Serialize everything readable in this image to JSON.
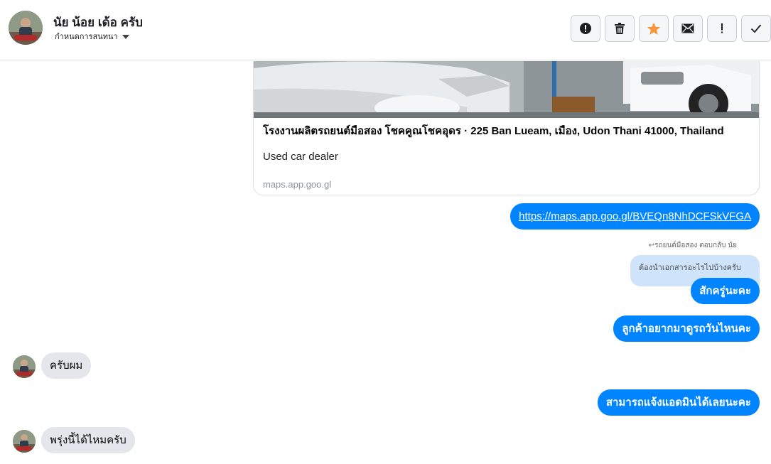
{
  "header": {
    "contact_name": "นัย น้อย เด้อ ครับ",
    "label_select": "กำหนดการสนทนา",
    "toolbar": [
      {
        "name": "report-button",
        "icon": "alert-circle-icon"
      },
      {
        "name": "delete-button",
        "icon": "trash-icon"
      },
      {
        "name": "star-button",
        "icon": "star-icon"
      },
      {
        "name": "mark-unread-button",
        "icon": "envelope-icon"
      },
      {
        "name": "important-button",
        "icon": "exclamation-icon"
      },
      {
        "name": "done-button",
        "icon": "checkmark-icon"
      }
    ]
  },
  "link_card": {
    "title": "โรงงานผลิตรถยนต์มือสอง โชคคูณโชคอุดร · 225 Ban Lueam, เมือง, Udon Thani 41000, Thailand",
    "description": "Used car dealer",
    "domain": "maps.app.goo.gl"
  },
  "messages": {
    "link_message": "https://maps.app.goo.gl/BVEQn8NhDCFSkVFGA",
    "reply_meta": "รถยนต์มือสอง ตอบกลับ นัย",
    "reply_quote": "ต้องนำเอกสารอะไรไปบ้างครับ",
    "reply_text": "สักครู่นะคะ",
    "out_1": "ลูกค้าอยากมาดูรถวันไหนคะ",
    "in_1": "ครับผม",
    "out_2": "สามารถแจ้งแอดมินได้เลยนะคะ",
    "in_2": "พรุ่งนี้ได้ไหมครับ"
  },
  "colors": {
    "accent": "#0084ff",
    "star": "#f6973b",
    "incoming_bubble": "#e4e6eb",
    "quote_bubble": "#cfe4fb"
  }
}
